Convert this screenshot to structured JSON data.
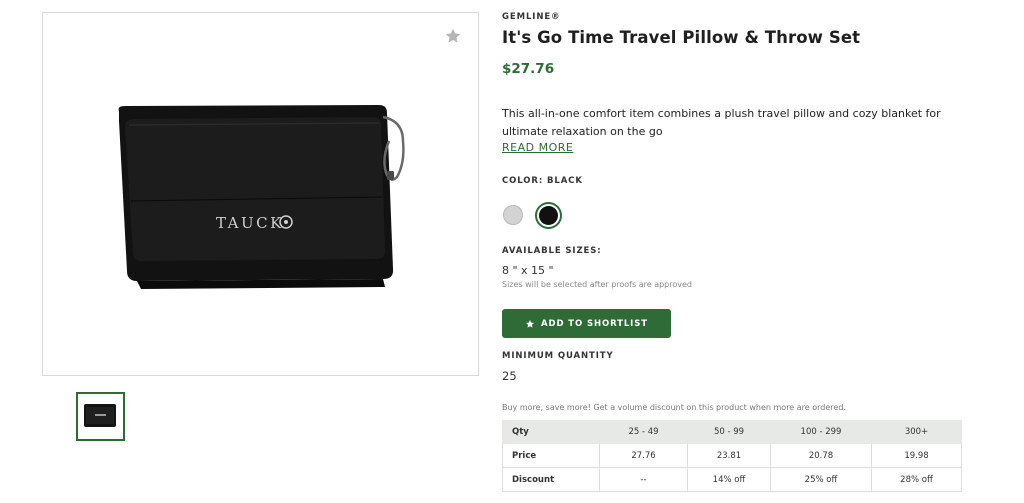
{
  "product": {
    "brand": "GEMLINE®",
    "title": "It's Go Time Travel Pillow & Throw Set",
    "price": "$27.76",
    "description": "This all-in-one comfort item combines a plush travel pillow and cozy blanket for ultimate relaxation on the go",
    "read_more": "READ MORE",
    "image_logo_text": "TAUCK"
  },
  "color": {
    "label": "COLOR: BLACK",
    "swatches": [
      {
        "name": "gray",
        "hex": "#d3d3d3",
        "selected": false
      },
      {
        "name": "black",
        "hex": "#111111",
        "selected": true
      }
    ],
    "accent": "#2e6b37"
  },
  "sizes": {
    "label": "AVAILABLE SIZES:",
    "value": "8 \" x 15 \"",
    "note": "Sizes will be selected after proofs are approved"
  },
  "shortlist": {
    "label": "ADD TO SHORTLIST",
    "icon": "star-icon"
  },
  "minimum_quantity": {
    "label": "MINIMUM QUANTITY",
    "value": "25"
  },
  "volume": {
    "note": "Buy more, save more! Get a volume discount on this product when more are ordered.",
    "header": [
      "Qty",
      "25 - 49",
      "50 - 99",
      "100 - 299",
      "300+"
    ],
    "price_row": [
      "Price",
      "27.76",
      "23.81",
      "20.78",
      "19.98"
    ],
    "discount_row": [
      "Discount",
      "--",
      "14% off",
      "25% off",
      "28% off"
    ]
  }
}
